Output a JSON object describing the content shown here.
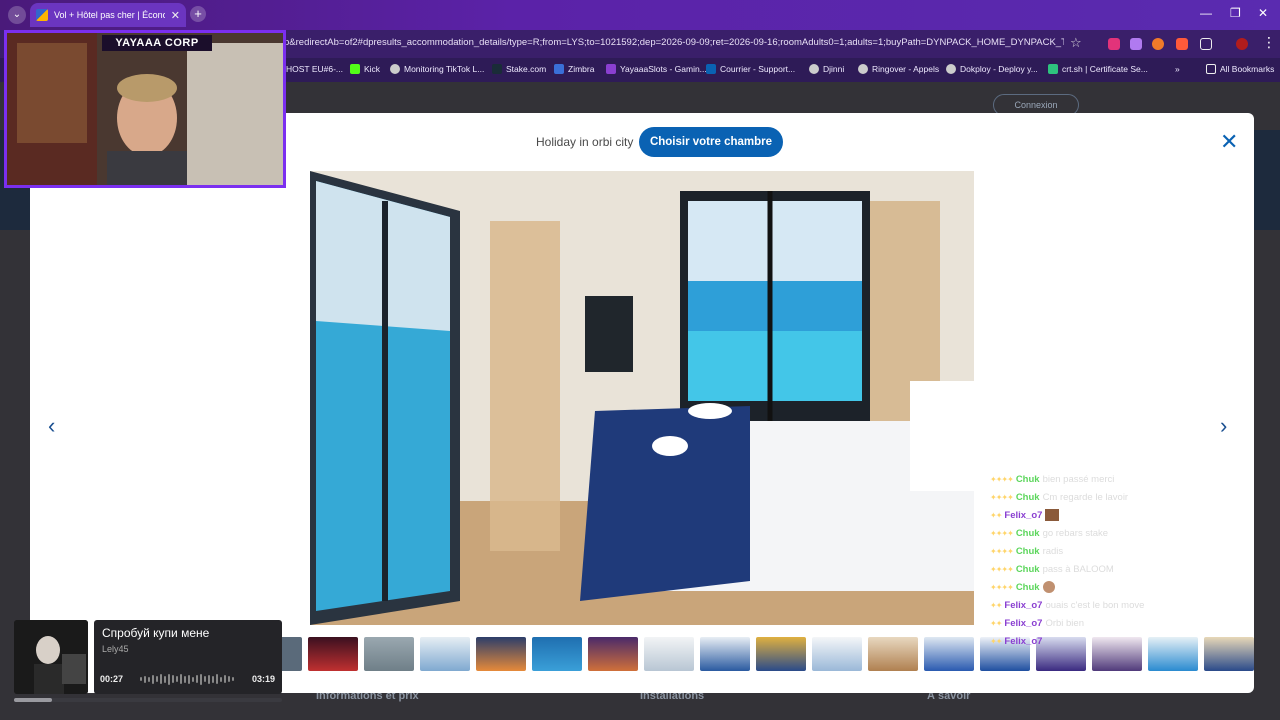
{
  "browser": {
    "tab_title": "Vol + Hôtel pas cher | Économie",
    "url": "p&redirectAb=of2#dpresults_accommodation_details/type=R;from=LYS;to=1021592;dep=2026-09-09;ret=2026-09-16;roomAdults0=1;adults=1;buyPath=DYNPACK_HOME_DYNPACK_TAB::",
    "bookmarks": [
      "HOST EU#6-...",
      "Kick",
      "Monitoring TikTok L...",
      "Stake.com",
      "Zimbra",
      "YayaaaSlots - Gamin...",
      "Courrier - Support...",
      "Djinni",
      "Ringover - Appels",
      "Dokploy - Deploy y...",
      "crt.sh | Certificate Se..."
    ],
    "all_bookmarks": "All Bookmarks",
    "more_bookmarks": "»"
  },
  "page": {
    "login": "Connexion",
    "tabs": [
      "Informations et prix",
      "Installations",
      "À savoir"
    ]
  },
  "modal": {
    "hotel_name": "Holiday in orbi city",
    "choose_button": "Choisir votre chambre",
    "close": "✕",
    "prev": "‹",
    "next": "›"
  },
  "webcam": {
    "label": "YAYAAA CORP"
  },
  "chat": [
    {
      "nick": "Chuk",
      "msg": "bien passé merci"
    },
    {
      "nick": "Chuk",
      "msg": "Cm regarde le lavoir"
    },
    {
      "nick": "Felix_o7",
      "msg": ""
    },
    {
      "nick": "Chuk",
      "msg": "go rebars stake"
    },
    {
      "nick": "Chuk",
      "msg": "radis"
    },
    {
      "nick": "Chuk",
      "msg": "pass à BALOOM"
    },
    {
      "nick": "Chuk",
      "msg": ""
    },
    {
      "nick": "Felix_o7",
      "msg": "ouais c'est le bon move"
    },
    {
      "nick": "Felix_o7",
      "msg": "Orbi bien"
    },
    {
      "nick": "Felix_o7",
      "msg": ""
    }
  ],
  "music": {
    "title": "Спробуй купи мене",
    "artist": "Lely45",
    "elapsed": "00:27",
    "duration": "03:19",
    "progress_fraction": 0.14
  }
}
